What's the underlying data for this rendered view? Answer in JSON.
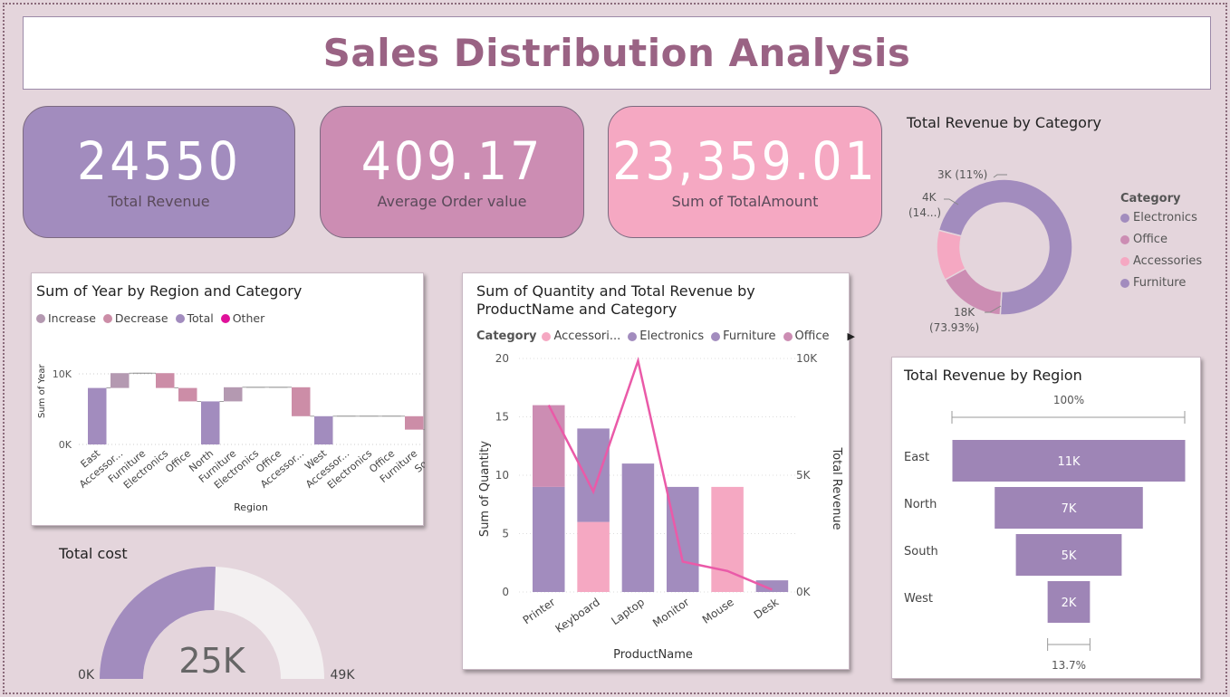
{
  "title": "Sales Distribution Analysis",
  "kpis": [
    {
      "value": "24550",
      "label": "Total Revenue",
      "color": "#a28cbe"
    },
    {
      "value": "409.17",
      "label": "Average Order value",
      "color": "#cc8db3"
    },
    {
      "value": "23,359.01",
      "label": "Sum of TotalAmount",
      "color": "#f5a8c2"
    }
  ],
  "donut": {
    "title": "Total Revenue by Category",
    "legend_title": "Category",
    "legend": [
      {
        "name": "Electronics",
        "color": "#a28cbe"
      },
      {
        "name": "Office",
        "color": "#cc8db3"
      },
      {
        "name": "Accessories",
        "color": "#f5a8c2"
      },
      {
        "name": "Furniture",
        "color": "#a28cbe"
      }
    ],
    "labels": {
      "a": "3K (11%)",
      "b1": "4K",
      "b2": "(14...)",
      "c1": "18K",
      "c2": "(73.93%)"
    }
  },
  "waterfall": {
    "title": "Sum of Year by Region and Category",
    "legend": [
      {
        "name": "Increase",
        "color": "#b499b1"
      },
      {
        "name": "Decrease",
        "color": "#cc8da7"
      },
      {
        "name": "Total",
        "color": "#a28cbe"
      },
      {
        "name": "Other",
        "color": "#e0119a"
      }
    ],
    "ylabel": "Sum of Year",
    "xlabel": "Region",
    "yticks": [
      "10K",
      "0K"
    ]
  },
  "combo": {
    "title_line1": "Sum of Quantity and Total Revenue by",
    "title_line2": "ProductName and Category",
    "legend_title": "Category",
    "legend": [
      {
        "name": "Accessori...",
        "color": "#f5a8c2"
      },
      {
        "name": "Electronics",
        "color": "#a28cbe"
      },
      {
        "name": "Furniture",
        "color": "#a28cbe"
      },
      {
        "name": "Office",
        "color": "#cc8db3"
      }
    ],
    "ylabel_left": "Sum of Quantity",
    "ylabel_right": "Total Revenue",
    "xlabel": "ProductName",
    "left_ticks": [
      "20",
      "15",
      "10",
      "5",
      "0"
    ],
    "right_ticks": [
      "10K",
      "5K",
      "0K"
    ]
  },
  "funnel": {
    "title": "Total Revenue by Region",
    "top_label": "100%",
    "bottom_label": "13.7%"
  },
  "gauge": {
    "title": "Total cost",
    "value_label": "25K",
    "min_label": "0K",
    "max_label": "49K",
    "value": 25000,
    "max": 49000,
    "fill_color": "#a28cbe",
    "track_color": "#f3f0f1"
  },
  "chart_data": [
    {
      "type": "bar",
      "title": "Sum of Year by Region and Category",
      "xlabel": "Region",
      "ylabel": "Sum of Year",
      "ylim": [
        0,
        10000
      ],
      "categories": [
        "East",
        "Accessor...",
        "Furniture",
        "Electronics",
        "Office",
        "North",
        "Furniture",
        "Electronics",
        "Office",
        "Accessor...",
        "West",
        "Accessor...",
        "Electronics",
        "Office",
        "Furniture",
        "South"
      ],
      "bars": [
        {
          "kind": "total",
          "start": 0,
          "end": 8000
        },
        {
          "kind": "increase",
          "start": 8000,
          "end": 10100
        },
        {
          "kind": "flat",
          "start": 10100,
          "end": 10100
        },
        {
          "kind": "decrease",
          "start": 10100,
          "end": 8000
        },
        {
          "kind": "decrease",
          "start": 8000,
          "end": 6100
        },
        {
          "kind": "total",
          "start": 0,
          "end": 6100
        },
        {
          "kind": "increase",
          "start": 6100,
          "end": 8100
        },
        {
          "kind": "flat",
          "start": 8100,
          "end": 8100
        },
        {
          "kind": "flat",
          "start": 8100,
          "end": 8100
        },
        {
          "kind": "decrease",
          "start": 8100,
          "end": 4000
        },
        {
          "kind": "total",
          "start": 0,
          "end": 4000
        },
        {
          "kind": "flat",
          "start": 4000,
          "end": 4000
        },
        {
          "kind": "flat",
          "start": 4000,
          "end": 4000
        },
        {
          "kind": "flat",
          "start": 4000,
          "end": 4000
        },
        {
          "kind": "decrease",
          "start": 4000,
          "end": 2100
        },
        {
          "kind": "total",
          "start": 0,
          "end": 2100
        }
      ]
    },
    {
      "type": "bar",
      "title": "Sum of Quantity and Total Revenue by ProductName and Category",
      "xlabel": "ProductName",
      "ylabel": "Sum of Quantity",
      "ylim": [
        0,
        20
      ],
      "categories": [
        "Printer",
        "Keyboard",
        "Laptop",
        "Monitor",
        "Mouse",
        "Desk"
      ],
      "stacks": [
        [
          {
            "category": "Electronics",
            "value": 9
          },
          {
            "category": "Office",
            "value": 7
          }
        ],
        [
          {
            "category": "Accessories",
            "value": 6
          },
          {
            "category": "Electronics",
            "value": 8
          }
        ],
        [
          {
            "category": "Electronics",
            "value": 11
          }
        ],
        [
          {
            "category": "Electronics",
            "value": 9
          }
        ],
        [
          {
            "category": "Accessories",
            "value": 9
          }
        ],
        [
          {
            "category": "Furniture",
            "value": 1
          }
        ]
      ],
      "line": {
        "name": "Total Revenue",
        "ylim": [
          0,
          10000
        ],
        "values": [
          8000,
          4300,
          9900,
          1300,
          900,
          100
        ]
      }
    },
    {
      "type": "pie",
      "title": "Total Revenue by Category",
      "slices": [
        {
          "name": "Electronics",
          "value": 18000,
          "percent": 73.93
        },
        {
          "name": "Office",
          "value": 4000,
          "percent": 14
        },
        {
          "name": "Accessories",
          "value": 3000,
          "percent": 11
        },
        {
          "name": "Furniture",
          "value": 0,
          "percent": 0
        }
      ]
    },
    {
      "type": "bar",
      "title": "Total Revenue by Region",
      "categories": [
        "East",
        "North",
        "South",
        "West"
      ],
      "values": [
        11000,
        7000,
        5000,
        2000
      ],
      "value_labels": [
        "11K",
        "7K",
        "5K",
        "2K"
      ],
      "top_percent": "100%",
      "bottom_percent": "13.7%"
    }
  ]
}
